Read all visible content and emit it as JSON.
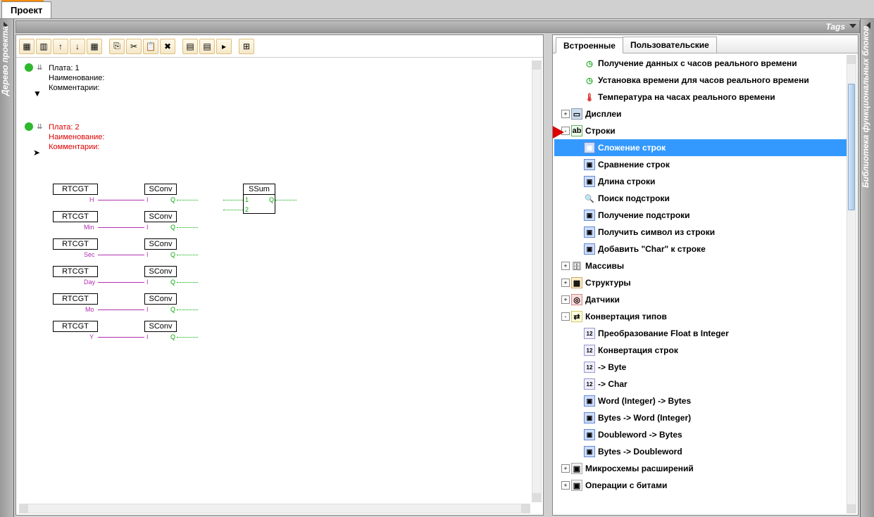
{
  "main_tab": "Проект",
  "left_sidebar": "Дерево проекта",
  "right_sidebar": "Библиотека функциональных блоков",
  "tags_label": "Tags",
  "boards": [
    {
      "plate": "Плата: 1",
      "name": "Наименование:",
      "comment": "Комментарии:",
      "color": "black"
    },
    {
      "plate": "Плата: 2",
      "name": "Наименование:",
      "comment": "Комментарии:",
      "color": "red"
    }
  ],
  "blocks": {
    "rtcgt": "RTCGT",
    "sconv": "SConv",
    "ssum": "SSum",
    "pins": [
      "H",
      "Min",
      "Sec",
      "Day",
      "Mo",
      "Y"
    ],
    "io": {
      "i": "I",
      "q": "Q",
      "one": "1",
      "two": "2"
    }
  },
  "lib_tabs": {
    "builtin": "Встроенные",
    "user": "Пользовательские"
  },
  "tree": [
    {
      "lvl": 2,
      "exp": "",
      "icon": "clock",
      "label": "Получение данных с часов реального времени"
    },
    {
      "lvl": 2,
      "exp": "",
      "icon": "clock",
      "label": "Установка времени для часов реального времени"
    },
    {
      "lvl": 2,
      "exp": "",
      "icon": "temp",
      "label": "Температура на часах реального времени"
    },
    {
      "lvl": 1,
      "exp": "+",
      "icon": "disp",
      "label": "Дисплеи"
    },
    {
      "lvl": 1,
      "exp": "-",
      "icon": "str",
      "label": "Строки"
    },
    {
      "lvl": 2,
      "exp": "",
      "icon": "block",
      "label": "Сложение строк",
      "selected": true
    },
    {
      "lvl": 2,
      "exp": "",
      "icon": "block",
      "label": "Сравнение строк"
    },
    {
      "lvl": 2,
      "exp": "",
      "icon": "block",
      "label": "Длина строки"
    },
    {
      "lvl": 2,
      "exp": "",
      "icon": "search",
      "label": "Поиск подстроки"
    },
    {
      "lvl": 2,
      "exp": "",
      "icon": "block",
      "label": "Получение подстроки"
    },
    {
      "lvl": 2,
      "exp": "",
      "icon": "block",
      "label": "Получить символ из строки"
    },
    {
      "lvl": 2,
      "exp": "",
      "icon": "block",
      "label": "Добавить \"Char\" к строке"
    },
    {
      "lvl": 1,
      "exp": "+",
      "icon": "db",
      "label": "Массивы"
    },
    {
      "lvl": 1,
      "exp": "+",
      "icon": "struct",
      "label": "Структуры"
    },
    {
      "lvl": 1,
      "exp": "+",
      "icon": "sensor",
      "label": "Датчики"
    },
    {
      "lvl": 1,
      "exp": "-",
      "icon": "conv",
      "label": "Конвертация типов"
    },
    {
      "lvl": 2,
      "exp": "",
      "icon": "num",
      "label": "Преобразование Float в Integer"
    },
    {
      "lvl": 2,
      "exp": "",
      "icon": "num",
      "label": "Конвертация строк"
    },
    {
      "lvl": 2,
      "exp": "",
      "icon": "num",
      "label": "-> Byte"
    },
    {
      "lvl": 2,
      "exp": "",
      "icon": "num",
      "label": "-> Char"
    },
    {
      "lvl": 2,
      "exp": "",
      "icon": "block",
      "label": "Word (Integer) -> Bytes"
    },
    {
      "lvl": 2,
      "exp": "",
      "icon": "block",
      "label": "Bytes -> Word (Integer)"
    },
    {
      "lvl": 2,
      "exp": "",
      "icon": "block",
      "label": "Doubleword -> Bytes"
    },
    {
      "lvl": 2,
      "exp": "",
      "icon": "block",
      "label": "Bytes -> Doubleword"
    },
    {
      "lvl": 1,
      "exp": "+",
      "icon": "ext",
      "label": "Микросхемы расширений"
    },
    {
      "lvl": 1,
      "exp": "+",
      "icon": "ext",
      "label": "Операции с битами"
    }
  ]
}
